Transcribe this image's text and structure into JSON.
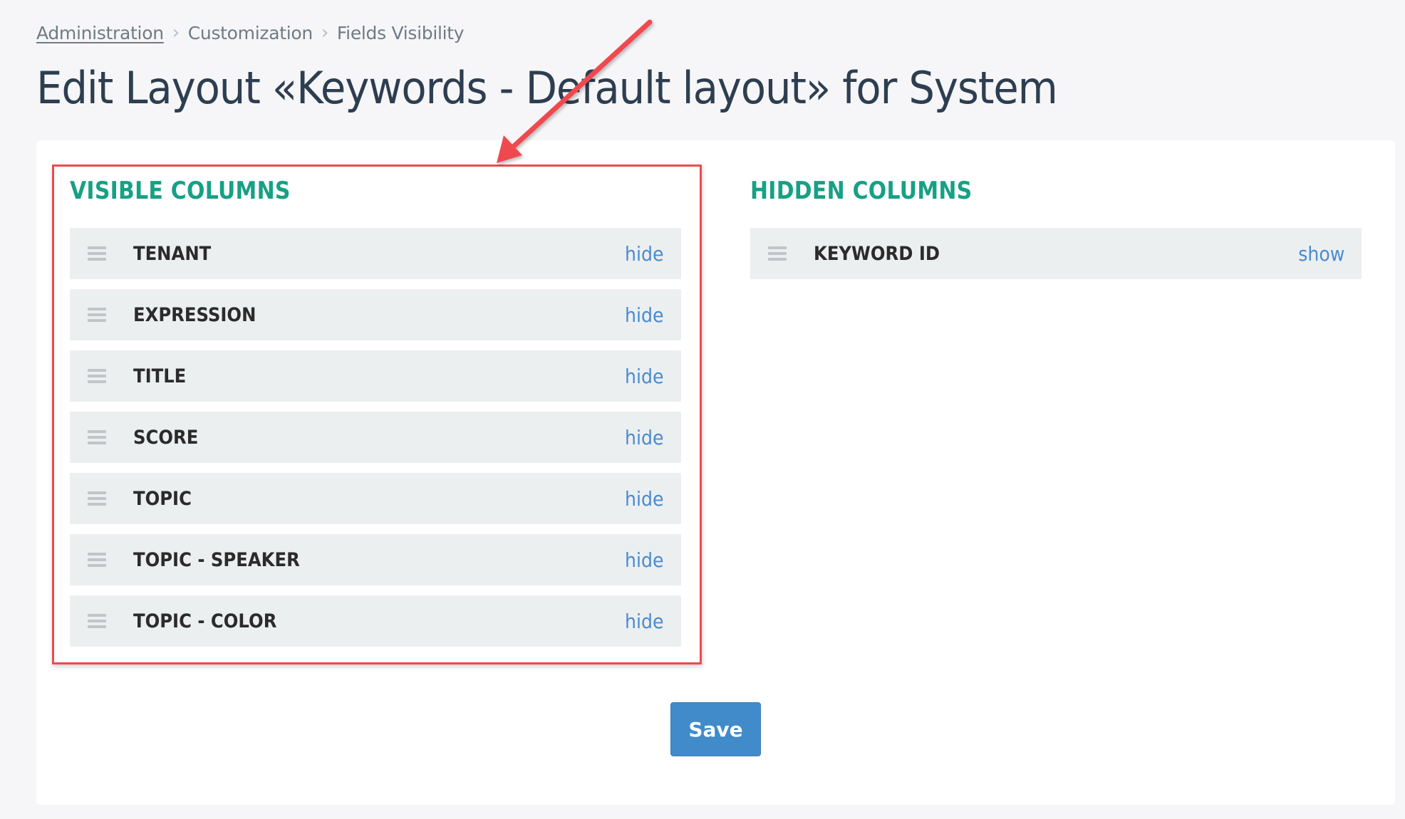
{
  "breadcrumb": {
    "items": [
      {
        "label": "Administration",
        "link": true
      },
      {
        "label": "Customization",
        "link": false
      },
      {
        "label": "Fields Visibility",
        "link": false
      }
    ],
    "separator": "›"
  },
  "page": {
    "title": "Edit Layout «Keywords - Default layout» for System"
  },
  "visible_columns": {
    "title": "VISIBLE COLUMNS",
    "action_label": "hide",
    "items": [
      {
        "label": "TENANT",
        "action": "hide"
      },
      {
        "label": "EXPRESSION",
        "action": "hide"
      },
      {
        "label": "TITLE",
        "action": "hide"
      },
      {
        "label": "SCORE",
        "action": "hide"
      },
      {
        "label": "TOPIC",
        "action": "hide"
      },
      {
        "label": "TOPIC - SPEAKER",
        "action": "hide"
      },
      {
        "label": "TOPIC - COLOR",
        "action": "hide"
      }
    ]
  },
  "hidden_columns": {
    "title": "HIDDEN COLUMNS",
    "items": [
      {
        "label": "KEYWORD ID",
        "action": "show"
      }
    ]
  },
  "actions": {
    "save_label": "Save"
  },
  "icons": {
    "drag_handle": "drag-handle-icon",
    "breadcrumb_separator": "chevron-right-icon",
    "annotation": "red-arrow-annotation"
  },
  "colors": {
    "section_title": "#17a085",
    "link": "#4a8bd0",
    "primary_button": "#418bca",
    "highlight": "#ef4a4f",
    "title_text": "#2d3e50"
  }
}
